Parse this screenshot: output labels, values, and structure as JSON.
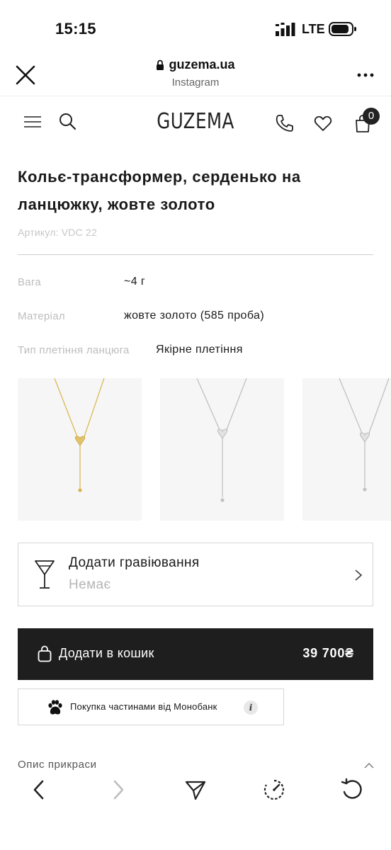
{
  "status_bar": {
    "time": "15:15",
    "network": "LTE",
    "signal_icon": "signal-bars-icon",
    "battery_icon": "battery-icon"
  },
  "browser": {
    "domain": "guzema.ua",
    "source": "Instagram",
    "close_icon": "close-icon",
    "lock_icon": "lock-icon",
    "more_icon": "more-icon"
  },
  "site_header": {
    "logo": "GUZEMA",
    "cart_count": "0",
    "icons": [
      "hamburger-menu-icon",
      "search-icon",
      "phone-icon",
      "heart-icon",
      "cart-icon"
    ]
  },
  "product": {
    "title": "Кольє-трансформер, серденько на ланцюжку, жовте золото",
    "sku": "Артикул: VDC 22",
    "specs": [
      {
        "label": "Вага",
        "value": "~4 г"
      },
      {
        "label": "Матеріал",
        "value": "жовте золото (585 проба)"
      },
      {
        "label": "Тип плетіння ланцюга",
        "value": "Якірне плетіння"
      }
    ],
    "gallery": [
      {
        "metal": "yellow-gold",
        "color": "#d9b44a"
      },
      {
        "metal": "white-gold",
        "color": "#bdbdbd"
      },
      {
        "metal": "white-gold",
        "color": "#bdbdbd"
      }
    ]
  },
  "engraving": {
    "title": "Додати гравіювання",
    "value": "Немає",
    "icon": "wine-glass-icon"
  },
  "cart": {
    "label": "Додати в кошик",
    "price": "39 700₴",
    "icon": "shopping-bag-icon"
  },
  "monobank": {
    "label": "Покупка частинами від Монобанк",
    "info": "i",
    "icon": "paw-icon"
  },
  "description": {
    "label": "Опис прикраси"
  },
  "toolbar": {
    "icons": [
      "back-arrow-icon",
      "forward-arrow-icon",
      "share-icon",
      "speed-icon",
      "reload-icon"
    ]
  },
  "colors": {
    "text": "#1a1a1a",
    "muted": "#bdbdbd",
    "button_bg": "#1e1e1e",
    "border": "#d6d6d6"
  }
}
